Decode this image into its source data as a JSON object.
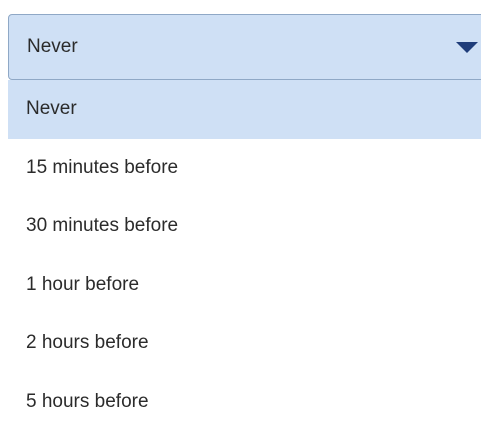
{
  "select": {
    "value": "Never"
  },
  "options": [
    {
      "label": "Never",
      "selected": true
    },
    {
      "label": "15 minutes before",
      "selected": false
    },
    {
      "label": "30 minutes before",
      "selected": false
    },
    {
      "label": "1 hour before",
      "selected": false
    },
    {
      "label": "2 hours before",
      "selected": false
    },
    {
      "label": "5 hours before",
      "selected": false
    }
  ],
  "colors": {
    "selected_bg": "#cfe0f5",
    "border": "#8fa8c6",
    "caret": "#1f3d7a",
    "text": "#2b2b2b"
  },
  "icons": {
    "caret": "chevron-down-icon"
  }
}
